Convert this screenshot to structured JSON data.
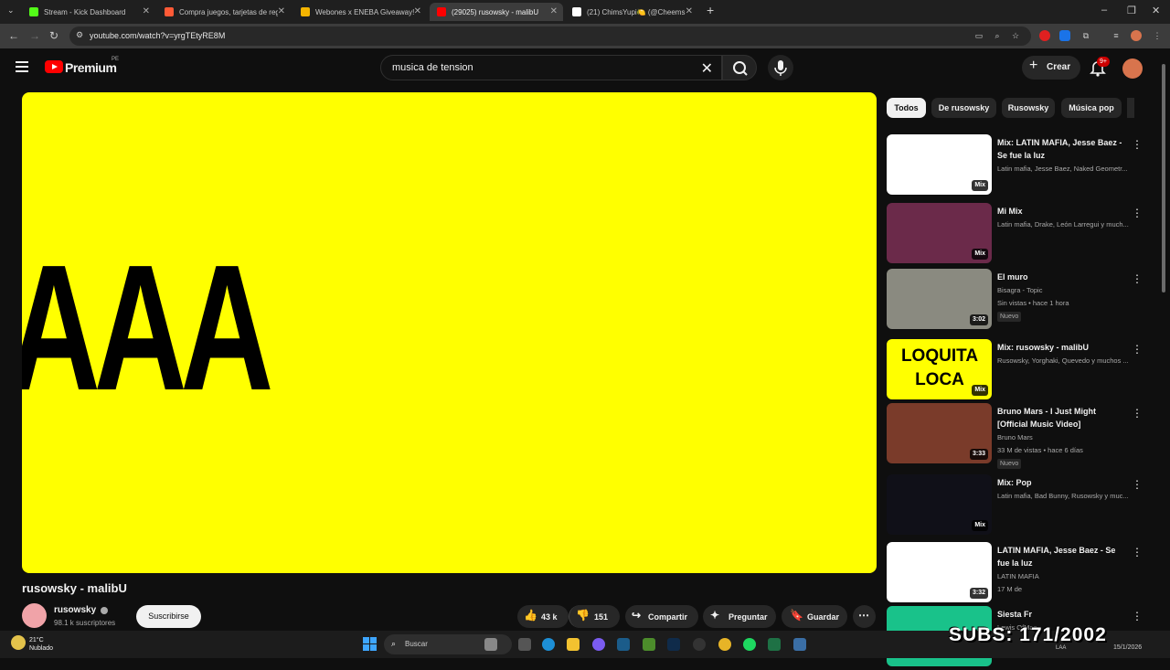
{
  "browser": {
    "tabs": [
      {
        "title": "Stream - Kick Dashboard",
        "favicon_color": "#53fc18"
      },
      {
        "title": "Compra juegos, tarjetas de reg",
        "favicon_color": "#ff5a36"
      },
      {
        "title": "Webones x ENEBA Giveaway!",
        "favicon_color": "#f4b400"
      },
      {
        "title": "(29025) rusowsky - malibU",
        "favicon_color": "#ff0000",
        "active": true
      },
      {
        "title": "(21) ChimsYupi🍋 (@CheemsP",
        "favicon_color": "#ffffff"
      }
    ],
    "new_tab": "+",
    "url": "youtube.com/watch?v=yrgTEtyRE8M"
  },
  "header": {
    "brand": "Premium",
    "region": "PE",
    "search_query": "musica de tension",
    "create_label": "Crear",
    "notifications": "9+"
  },
  "video": {
    "overlay_text": "AAA",
    "background": "#ffff00",
    "title": "rusowsky - malibU",
    "channel": "rusowsky",
    "subscribers": "98.1 k suscriptores",
    "subscribe_label": "Suscribirse",
    "likes": "43 k",
    "dislikes": "151",
    "share_label": "Compartir",
    "ask_label": "Preguntar",
    "save_label": "Guardar"
  },
  "chips": [
    "Todos",
    "De rusowsky",
    "Rusowsky",
    "Música pop"
  ],
  "recommendations": [
    {
      "title": "Mix: LATIN MAFIA, Jesse Baez - Se fue la luz",
      "meta1": "Latin mafia, Jesse Baez, Naked Geometr...",
      "meta2": "",
      "badge": "Mix",
      "nuevo": "",
      "thumb_color": "#ffffff",
      "thumb_text": ""
    },
    {
      "title": "Mi Mix",
      "meta1": "Latin mafia, Drake, León Larregui y much...",
      "meta2": "",
      "badge": "Mix",
      "nuevo": "",
      "thumb_color": "#6b2a4a",
      "thumb_text": ""
    },
    {
      "title": "El muro",
      "meta1": "Bisagra - Topic",
      "meta2": "Sin vistas • hace 1 hora",
      "badge": "3:02",
      "nuevo": "Nuevo",
      "thumb_color": "#8a8a80",
      "thumb_text": ""
    },
    {
      "title": "Mix: rusowsky - malibU",
      "meta1": "Rusowsky, Yorghaki, Quevedo y muchos ...",
      "meta2": "",
      "badge": "Mix",
      "nuevo": "",
      "thumb_color": "#ffff00",
      "thumb_text": "LOQUITA LOCA"
    },
    {
      "title": "Bruno Mars - I Just Might [Official Music Video]",
      "meta1": "Bruno Mars",
      "meta2": "33 M de vistas • hace 6 días",
      "badge": "3:33",
      "nuevo": "Nuevo",
      "thumb_color": "#7a3b2a",
      "thumb_text": ""
    },
    {
      "title": "Mix: Pop",
      "meta1": "Latin mafia, Bad Bunny, Rusowsky y muc...",
      "meta2": "",
      "badge": "Mix",
      "nuevo": "",
      "thumb_color": "#101018",
      "thumb_text": ""
    },
    {
      "title": "LATIN MAFIA, Jesse Baez - Se fue la luz",
      "meta1": "LATIN MAFIA",
      "meta2": "17 M de",
      "badge": "3:32",
      "nuevo": "",
      "thumb_color": "#ffffff",
      "thumb_text": ""
    },
    {
      "title": "Siesta Fr",
      "meta1": "Lewis OfMan",
      "meta2": "",
      "badge": "",
      "nuevo": "",
      "thumb_color": "#19c28a",
      "thumb_text": ""
    }
  ],
  "taskbar": {
    "temperature": "21°C",
    "condition": "Nublado",
    "search_label": "Buscar",
    "tray_text": "LAA",
    "date": "15/1/2026",
    "subs_overlay": "SUBS: 171/2002"
  }
}
